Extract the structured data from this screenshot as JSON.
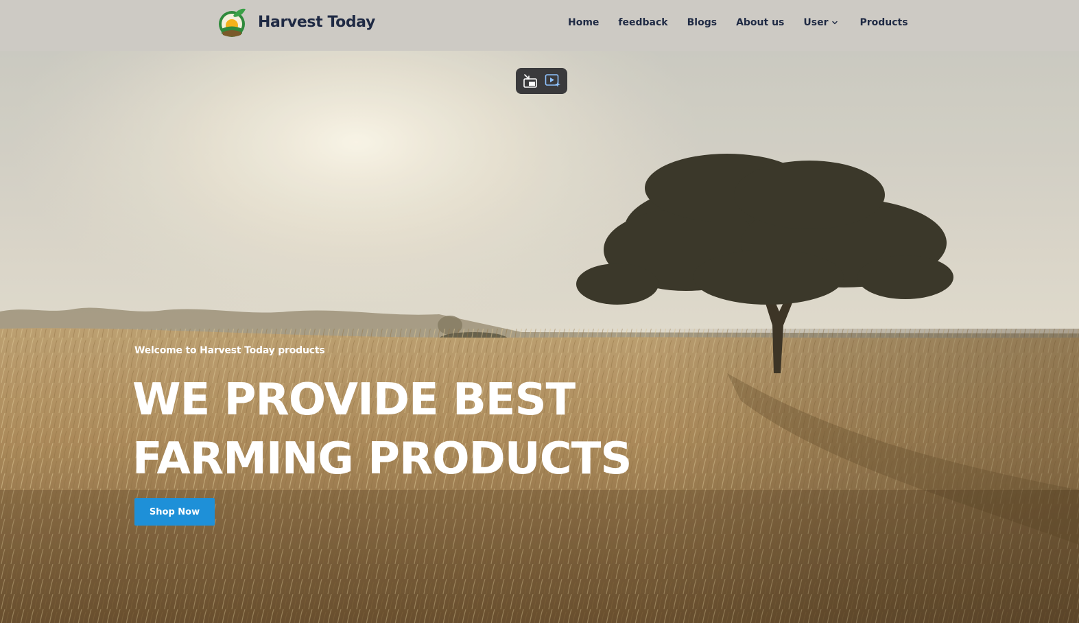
{
  "header": {
    "brand": "Harvest Today",
    "nav": [
      {
        "label": "Home"
      },
      {
        "label": "feedback"
      },
      {
        "label": "Blogs"
      },
      {
        "label": "About us"
      },
      {
        "label": "User",
        "has_dropdown": true
      },
      {
        "label": "Products"
      }
    ]
  },
  "hero": {
    "welcome": "Welcome to Harvest Today products",
    "headline_line1": "We Provide Best",
    "headline_line2": "Farming Products",
    "cta_label": "Shop Now"
  },
  "video_controls": {
    "icons": [
      "exit-picture-in-picture-icon",
      "video-enhance-icon"
    ]
  },
  "colors": {
    "header_bg": "#cdcac4",
    "nav_text": "#1f2a44",
    "cta_bg": "#1e90d8",
    "hero_text": "#ffffff"
  }
}
